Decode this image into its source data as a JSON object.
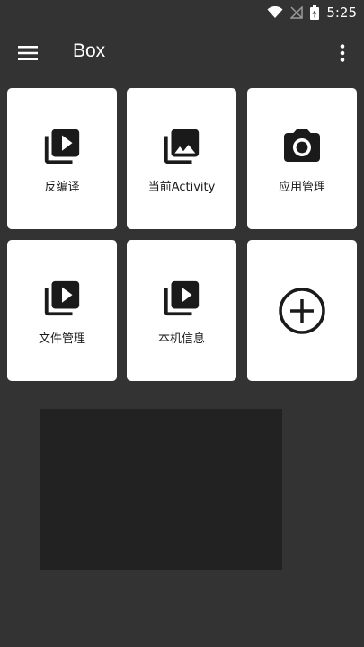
{
  "status": {
    "time": "5:25",
    "icons": [
      "wifi-icon",
      "signal-off-icon",
      "battery-charging-icon"
    ]
  },
  "appbar": {
    "title": "Box",
    "menu_icon": "hamburger-menu-icon",
    "more_icon": "more-vert-icon"
  },
  "tiles": [
    {
      "label": "反编译",
      "icon": "video-library-icon"
    },
    {
      "label": "当前Activity",
      "icon": "photo-library-icon"
    },
    {
      "label": "应用管理",
      "icon": "camera-icon"
    },
    {
      "label": "文件管理",
      "icon": "video-library-icon"
    },
    {
      "label": "本机信息",
      "icon": "video-library-icon"
    },
    {
      "label": "",
      "icon": "add-circle-icon"
    }
  ],
  "colors": {
    "background": "#333333",
    "tile": "#ffffff",
    "icon": "#1a1a1a",
    "ad_area": "#222222"
  }
}
